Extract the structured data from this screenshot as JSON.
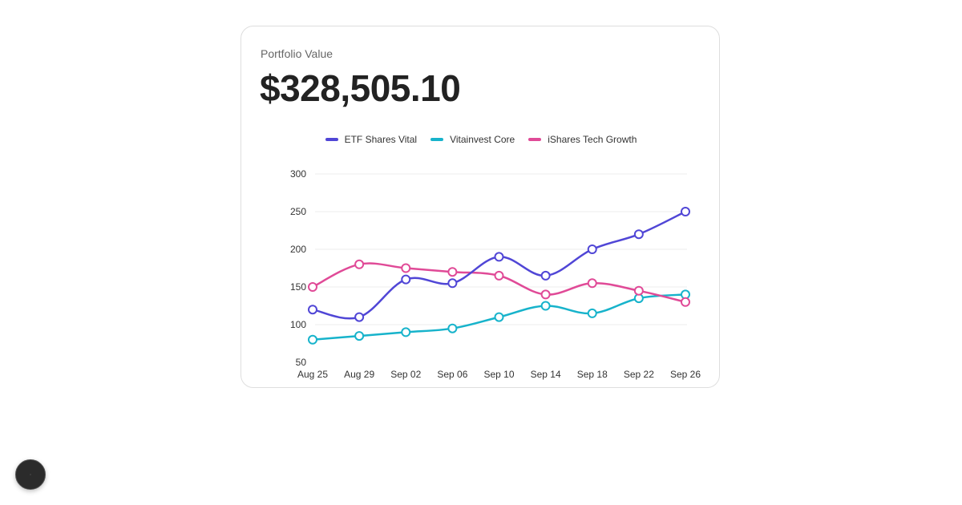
{
  "card": {
    "label": "Portfolio Value",
    "value": "$328,505.10"
  },
  "chart_data": {
    "type": "line",
    "categories": [
      "Aug 25",
      "Aug 29",
      "Sep 02",
      "Sep 06",
      "Sep 10",
      "Sep 14",
      "Sep 18",
      "Sep 22",
      "Sep 26"
    ],
    "series": [
      {
        "name": "ETF Shares Vital",
        "color": "#5046d6",
        "values": [
          120,
          110,
          160,
          155,
          190,
          165,
          200,
          220,
          250
        ]
      },
      {
        "name": "Vitainvest Core",
        "color": "#17b3cb",
        "values": [
          80,
          85,
          90,
          95,
          110,
          125,
          115,
          135,
          140
        ]
      },
      {
        "name": "iShares Tech Growth",
        "color": "#e04a97",
        "values": [
          150,
          180,
          175,
          170,
          165,
          140,
          155,
          145,
          130
        ]
      }
    ],
    "title": "",
    "xlabel": "",
    "ylabel": "",
    "ylim": [
      50,
      300
    ],
    "yticks": [
      "50",
      "100",
      "150",
      "200",
      "250",
      "300"
    ],
    "grid": true,
    "legend_position": "top-center"
  },
  "fab": {
    "icon": "dot-icon"
  }
}
